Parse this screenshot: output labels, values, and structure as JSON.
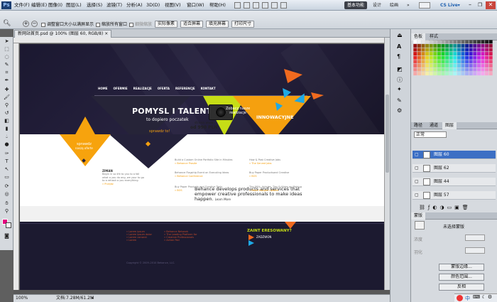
{
  "app": {
    "logo": "Ps"
  },
  "menu": [
    "文件(F)",
    "编辑(E)",
    "图像(I)",
    "图层(L)",
    "选择(S)",
    "滤镜(T)",
    "分析(A)",
    "3D(D)",
    "视图(V)",
    "窗口(W)",
    "帮助(H)"
  ],
  "workspace": {
    "essentials": "基本功能",
    "design": "设计",
    "painting": "绘画",
    "more": "»",
    "cslive": "CS Live▾"
  },
  "options": {
    "zoom_value": "100%",
    "resize_window_label": "调整窗口大小以满屏显示",
    "zoom_all_label": "缩放所有窗口",
    "scrubby_label": "细微缩放",
    "actual_pixels": "实际像素",
    "fit_screen": "适合屏幕",
    "fill_screen": "填充屏幕",
    "print_size": "打印尺寸"
  },
  "document": {
    "tab_title": "新网站首页.psd @ 100% (图层 60, RGB/8)",
    "status_zoom": "100%",
    "status_doc": "文档:7.28M/61.2M"
  },
  "website": {
    "nav": [
      "HOME",
      "OFERMIE",
      "REALIZACJE",
      "OFERTA",
      "REFERENCJE",
      "KONTAKT"
    ],
    "headline": "POMYSL I TALENT",
    "subhead": "to dopiero poczatek",
    "sprawdz_to": "sprawdz to!",
    "camera_text_1": "strona www",
    "camera_text_2": "od 990 PLN",
    "zobacz_1": "Zobacz nasze",
    "zobacz_2": "realizacje",
    "innowacyjne": "INNOWACYJNE",
    "rozwiazania": "rozwiązania",
    "sprawdz_left_1": "sprawdz",
    "sprawdz_left_2": "naszą oferte",
    "behance_main": "Behance develops products and services that empower creative professionals to make ideas happen.",
    "learn_more": "Learn More",
    "left_col_title": "ZIMAN",
    "left_col_text": "Begin in so life to you to a fall what a you do ang, we your to go to a rehash a you everything",
    "left_col_link": "» Przejdz",
    "items": [
      {
        "title": "Build a Custom Online Portfolio Site in Minutes",
        "link": "» Behance Prosite"
      },
      {
        "title": "How & Post Creative Jobs",
        "link": "» The Served Jobs"
      },
      {
        "title": "Behance Flagship Event on Executing Ideas",
        "link": "» Behance Conference"
      },
      {
        "title": "Buy Paper Productsand Creative",
        "link": "» BOS"
      },
      {
        "title": "Buy Paper Products and Creative Tools",
        "link": "» BOS"
      },
      {
        "title": "The 99%: Articles, Tips & Video on Making",
        "link": "» Make Happen Update"
      }
    ],
    "footer_col1": [
      "» Lorem ipsum",
      "» Lorem ipsum dolor",
      "» Lorem consect",
      "» Lorem"
    ],
    "footer_col2": [
      "» Behance Network",
      "» The Leading Platform for",
      "» Creative Professionals",
      "» Action Pad"
    ],
    "zaint": "ZAINT ERESOWANY?",
    "zadzwon": "ZADZWON",
    "copyright": "Copyright © 2009–2010 Behance, LLC."
  },
  "panels": {
    "swatch_tabs": [
      "色板",
      "样式"
    ],
    "layers_tabs": [
      "路径",
      "通道",
      "图层"
    ],
    "blend_mode": "正常",
    "layers": [
      {
        "name": "图层 60",
        "selected": true
      },
      {
        "name": "图层 62",
        "selected": false
      },
      {
        "name": "图层 44",
        "selected": false
      },
      {
        "name": "图层 57",
        "selected": false
      }
    ],
    "props_tab": "蒙版",
    "props_label": "未选择蒙版",
    "props_btn_1": "蒙版边缘...",
    "props_btn_2": "颜色范围...",
    "props_btn_3": "反相",
    "props_density": "浓度",
    "props_feather": "羽化"
  },
  "taskbar": {
    "ime": "中"
  }
}
